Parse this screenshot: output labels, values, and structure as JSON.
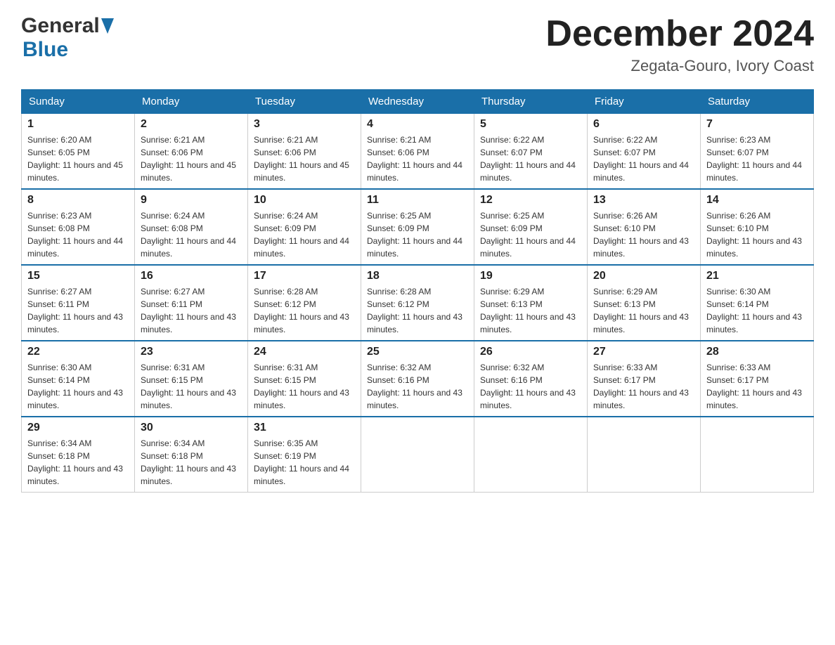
{
  "header": {
    "logo_general": "General",
    "logo_blue": "Blue",
    "month_title": "December 2024",
    "location": "Zegata-Gouro, Ivory Coast"
  },
  "days_of_week": [
    "Sunday",
    "Monday",
    "Tuesday",
    "Wednesday",
    "Thursday",
    "Friday",
    "Saturday"
  ],
  "weeks": [
    [
      {
        "day": "1",
        "sunrise": "6:20 AM",
        "sunset": "6:05 PM",
        "daylight": "11 hours and 45 minutes."
      },
      {
        "day": "2",
        "sunrise": "6:21 AM",
        "sunset": "6:06 PM",
        "daylight": "11 hours and 45 minutes."
      },
      {
        "day": "3",
        "sunrise": "6:21 AM",
        "sunset": "6:06 PM",
        "daylight": "11 hours and 45 minutes."
      },
      {
        "day": "4",
        "sunrise": "6:21 AM",
        "sunset": "6:06 PM",
        "daylight": "11 hours and 44 minutes."
      },
      {
        "day": "5",
        "sunrise": "6:22 AM",
        "sunset": "6:07 PM",
        "daylight": "11 hours and 44 minutes."
      },
      {
        "day": "6",
        "sunrise": "6:22 AM",
        "sunset": "6:07 PM",
        "daylight": "11 hours and 44 minutes."
      },
      {
        "day": "7",
        "sunrise": "6:23 AM",
        "sunset": "6:07 PM",
        "daylight": "11 hours and 44 minutes."
      }
    ],
    [
      {
        "day": "8",
        "sunrise": "6:23 AM",
        "sunset": "6:08 PM",
        "daylight": "11 hours and 44 minutes."
      },
      {
        "day": "9",
        "sunrise": "6:24 AM",
        "sunset": "6:08 PM",
        "daylight": "11 hours and 44 minutes."
      },
      {
        "day": "10",
        "sunrise": "6:24 AM",
        "sunset": "6:09 PM",
        "daylight": "11 hours and 44 minutes."
      },
      {
        "day": "11",
        "sunrise": "6:25 AM",
        "sunset": "6:09 PM",
        "daylight": "11 hours and 44 minutes."
      },
      {
        "day": "12",
        "sunrise": "6:25 AM",
        "sunset": "6:09 PM",
        "daylight": "11 hours and 44 minutes."
      },
      {
        "day": "13",
        "sunrise": "6:26 AM",
        "sunset": "6:10 PM",
        "daylight": "11 hours and 43 minutes."
      },
      {
        "day": "14",
        "sunrise": "6:26 AM",
        "sunset": "6:10 PM",
        "daylight": "11 hours and 43 minutes."
      }
    ],
    [
      {
        "day": "15",
        "sunrise": "6:27 AM",
        "sunset": "6:11 PM",
        "daylight": "11 hours and 43 minutes."
      },
      {
        "day": "16",
        "sunrise": "6:27 AM",
        "sunset": "6:11 PM",
        "daylight": "11 hours and 43 minutes."
      },
      {
        "day": "17",
        "sunrise": "6:28 AM",
        "sunset": "6:12 PM",
        "daylight": "11 hours and 43 minutes."
      },
      {
        "day": "18",
        "sunrise": "6:28 AM",
        "sunset": "6:12 PM",
        "daylight": "11 hours and 43 minutes."
      },
      {
        "day": "19",
        "sunrise": "6:29 AM",
        "sunset": "6:13 PM",
        "daylight": "11 hours and 43 minutes."
      },
      {
        "day": "20",
        "sunrise": "6:29 AM",
        "sunset": "6:13 PM",
        "daylight": "11 hours and 43 minutes."
      },
      {
        "day": "21",
        "sunrise": "6:30 AM",
        "sunset": "6:14 PM",
        "daylight": "11 hours and 43 minutes."
      }
    ],
    [
      {
        "day": "22",
        "sunrise": "6:30 AM",
        "sunset": "6:14 PM",
        "daylight": "11 hours and 43 minutes."
      },
      {
        "day": "23",
        "sunrise": "6:31 AM",
        "sunset": "6:15 PM",
        "daylight": "11 hours and 43 minutes."
      },
      {
        "day": "24",
        "sunrise": "6:31 AM",
        "sunset": "6:15 PM",
        "daylight": "11 hours and 43 minutes."
      },
      {
        "day": "25",
        "sunrise": "6:32 AM",
        "sunset": "6:16 PM",
        "daylight": "11 hours and 43 minutes."
      },
      {
        "day": "26",
        "sunrise": "6:32 AM",
        "sunset": "6:16 PM",
        "daylight": "11 hours and 43 minutes."
      },
      {
        "day": "27",
        "sunrise": "6:33 AM",
        "sunset": "6:17 PM",
        "daylight": "11 hours and 43 minutes."
      },
      {
        "day": "28",
        "sunrise": "6:33 AM",
        "sunset": "6:17 PM",
        "daylight": "11 hours and 43 minutes."
      }
    ],
    [
      {
        "day": "29",
        "sunrise": "6:34 AM",
        "sunset": "6:18 PM",
        "daylight": "11 hours and 43 minutes."
      },
      {
        "day": "30",
        "sunrise": "6:34 AM",
        "sunset": "6:18 PM",
        "daylight": "11 hours and 43 minutes."
      },
      {
        "day": "31",
        "sunrise": "6:35 AM",
        "sunset": "6:19 PM",
        "daylight": "11 hours and 44 minutes."
      },
      null,
      null,
      null,
      null
    ]
  ],
  "labels": {
    "sunrise_prefix": "Sunrise: ",
    "sunset_prefix": "Sunset: ",
    "daylight_prefix": "Daylight: "
  }
}
